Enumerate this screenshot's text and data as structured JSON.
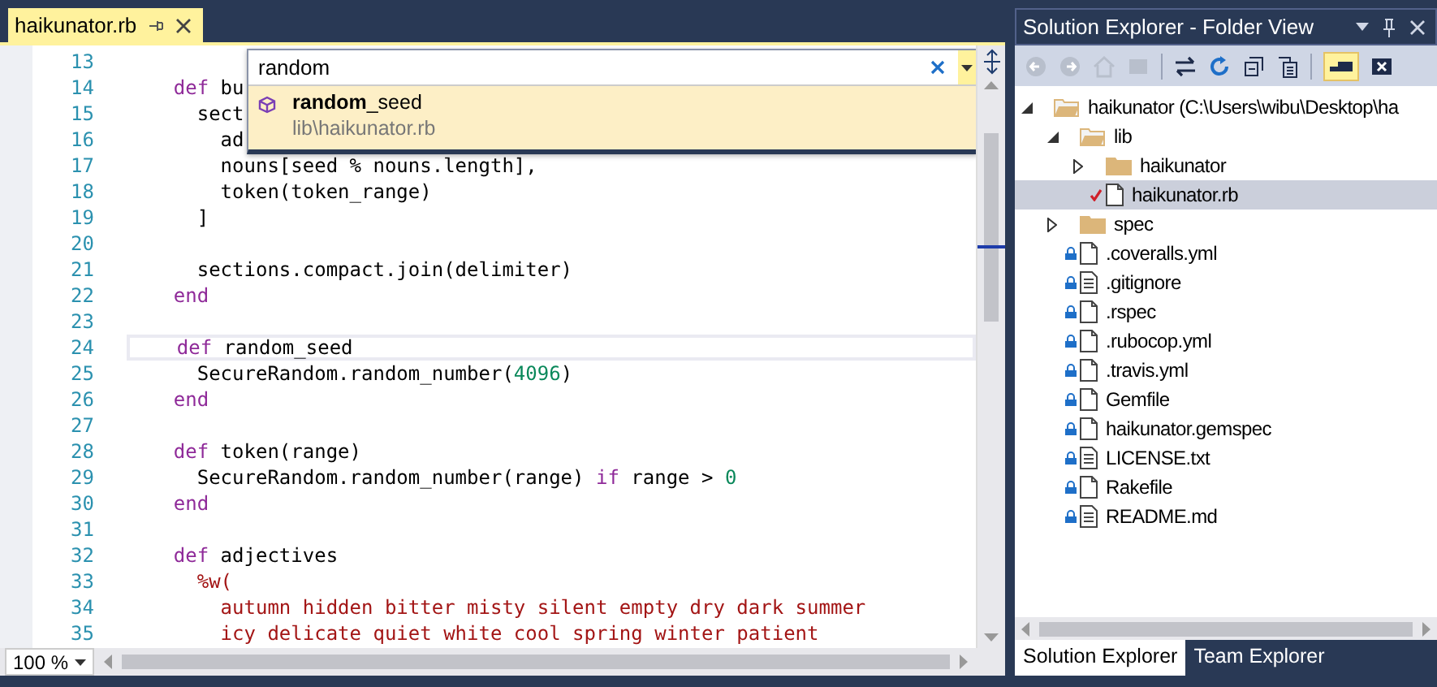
{
  "editor": {
    "tab": {
      "label": "haikunator.rb",
      "selected": true
    },
    "lines": [
      {
        "number": "13",
        "current": false
      },
      {
        "number": "14",
        "current": false,
        "tokens": [
          {
            "kind": "kw",
            "t": "    def"
          },
          {
            "kind": "plain",
            "t": " bu"
          }
        ]
      },
      {
        "number": "15",
        "current": false,
        "tokens": [
          {
            "kind": "plain",
            "t": "      sect"
          }
        ]
      },
      {
        "number": "16",
        "current": false,
        "tokens": [
          {
            "kind": "plain",
            "t": "        ad"
          }
        ]
      },
      {
        "number": "17",
        "current": false,
        "tokens": [
          {
            "kind": "plain",
            "t": "        nouns[seed % nouns.length],"
          }
        ]
      },
      {
        "number": "18",
        "current": false,
        "tokens": [
          {
            "kind": "plain",
            "t": "        token(token_range)"
          }
        ]
      },
      {
        "number": "19",
        "current": false,
        "tokens": [
          {
            "kind": "plain",
            "t": "      ]"
          }
        ]
      },
      {
        "number": "20",
        "current": false
      },
      {
        "number": "21",
        "current": false,
        "tokens": [
          {
            "kind": "plain",
            "t": "      sections.compact.join(delimiter)"
          }
        ]
      },
      {
        "number": "22",
        "current": false,
        "tokens": [
          {
            "kind": "kw",
            "t": "    end"
          }
        ]
      },
      {
        "number": "23",
        "current": false
      },
      {
        "number": "24",
        "current": true,
        "tokens": [
          {
            "kind": "kw",
            "t": "    def"
          },
          {
            "kind": "plain",
            "t": " random_seed"
          }
        ]
      },
      {
        "number": "25",
        "current": false,
        "tokens": [
          {
            "kind": "plain",
            "t": "      SecureRandom.random_number("
          },
          {
            "kind": "num",
            "t": "4096"
          },
          {
            "kind": "plain",
            "t": ")"
          }
        ]
      },
      {
        "number": "26",
        "current": false,
        "tokens": [
          {
            "kind": "kw",
            "t": "    end"
          }
        ]
      },
      {
        "number": "27",
        "current": false
      },
      {
        "number": "28",
        "current": false,
        "tokens": [
          {
            "kind": "kw",
            "t": "    def"
          },
          {
            "kind": "plain",
            "t": " token(range)"
          }
        ]
      },
      {
        "number": "29",
        "current": false,
        "tokens": [
          {
            "kind": "plain",
            "t": "      SecureRandom.random_number(range) "
          },
          {
            "kind": "kw",
            "t": "if"
          },
          {
            "kind": "plain",
            "t": " range > "
          },
          {
            "kind": "num",
            "t": "0"
          }
        ]
      },
      {
        "number": "30",
        "current": false,
        "tokens": [
          {
            "kind": "kw",
            "t": "    end"
          }
        ]
      },
      {
        "number": "31",
        "current": false
      },
      {
        "number": "32",
        "current": false,
        "tokens": [
          {
            "kind": "kw",
            "t": "    def"
          },
          {
            "kind": "plain",
            "t": " adjectives"
          }
        ]
      },
      {
        "number": "33",
        "current": false,
        "tokens": [
          {
            "kind": "str",
            "t": "      %w("
          }
        ]
      },
      {
        "number": "34",
        "current": false,
        "tokens": [
          {
            "kind": "str",
            "t": "        autumn hidden bitter misty silent empty dry dark summer"
          }
        ]
      },
      {
        "number": "35",
        "current": false,
        "tokens": [
          {
            "kind": "str",
            "t": "        icy delicate quiet white cool spring winter patient"
          }
        ]
      }
    ],
    "navigate": {
      "query": "random",
      "results": [
        {
          "name": "**random**_seed",
          "path": "lib\\haikunator.rb",
          "selected": true
        }
      ]
    },
    "zoom": "100 %"
  },
  "explorer": {
    "title": "Solution Explorer - Folder View",
    "tree": [
      {
        "label": "haikunator (C:\\Users\\wibu\\Desktop\\ha",
        "kind": "folder",
        "expanded": true,
        "selected": false,
        "children": [
          {
            "label": "lib",
            "kind": "folder",
            "expanded": true,
            "selected": false,
            "children": [
              {
                "label": "haikunator",
                "kind": "folder",
                "expanded": false,
                "selected": false
              },
              {
                "label": "haikunator.rb",
                "kind": "file",
                "locked": false,
                "pending": true,
                "selected": true
              }
            ]
          },
          {
            "label": "spec",
            "kind": "folder",
            "expanded": false,
            "selected": false
          },
          {
            "label": ".coveralls.yml",
            "kind": "file",
            "locked": true,
            "pending": false,
            "selected": false
          },
          {
            "label": ".gitignore",
            "kind": "text",
            "locked": true,
            "pending": false,
            "selected": false
          },
          {
            "label": ".rspec",
            "kind": "file",
            "locked": true,
            "pending": false,
            "selected": false
          },
          {
            "label": ".rubocop.yml",
            "kind": "file",
            "locked": true,
            "pending": false,
            "selected": false
          },
          {
            "label": ".travis.yml",
            "kind": "file",
            "locked": true,
            "pending": false,
            "selected": false
          },
          {
            "label": "Gemfile",
            "kind": "file",
            "locked": true,
            "pending": false,
            "selected": false
          },
          {
            "label": "haikunator.gemspec",
            "kind": "file",
            "locked": true,
            "pending": false,
            "selected": false
          },
          {
            "label": "LICENSE.txt",
            "kind": "text",
            "locked": true,
            "pending": false,
            "selected": false
          },
          {
            "label": "Rakefile",
            "kind": "file",
            "locked": true,
            "pending": false,
            "selected": false
          },
          {
            "label": "README.md",
            "kind": "text",
            "locked": true,
            "pending": false,
            "selected": false
          }
        ]
      }
    ],
    "tabs": [
      {
        "label": "Solution Explorer",
        "selected": true
      },
      {
        "label": "Team Explorer",
        "selected": false
      }
    ]
  }
}
